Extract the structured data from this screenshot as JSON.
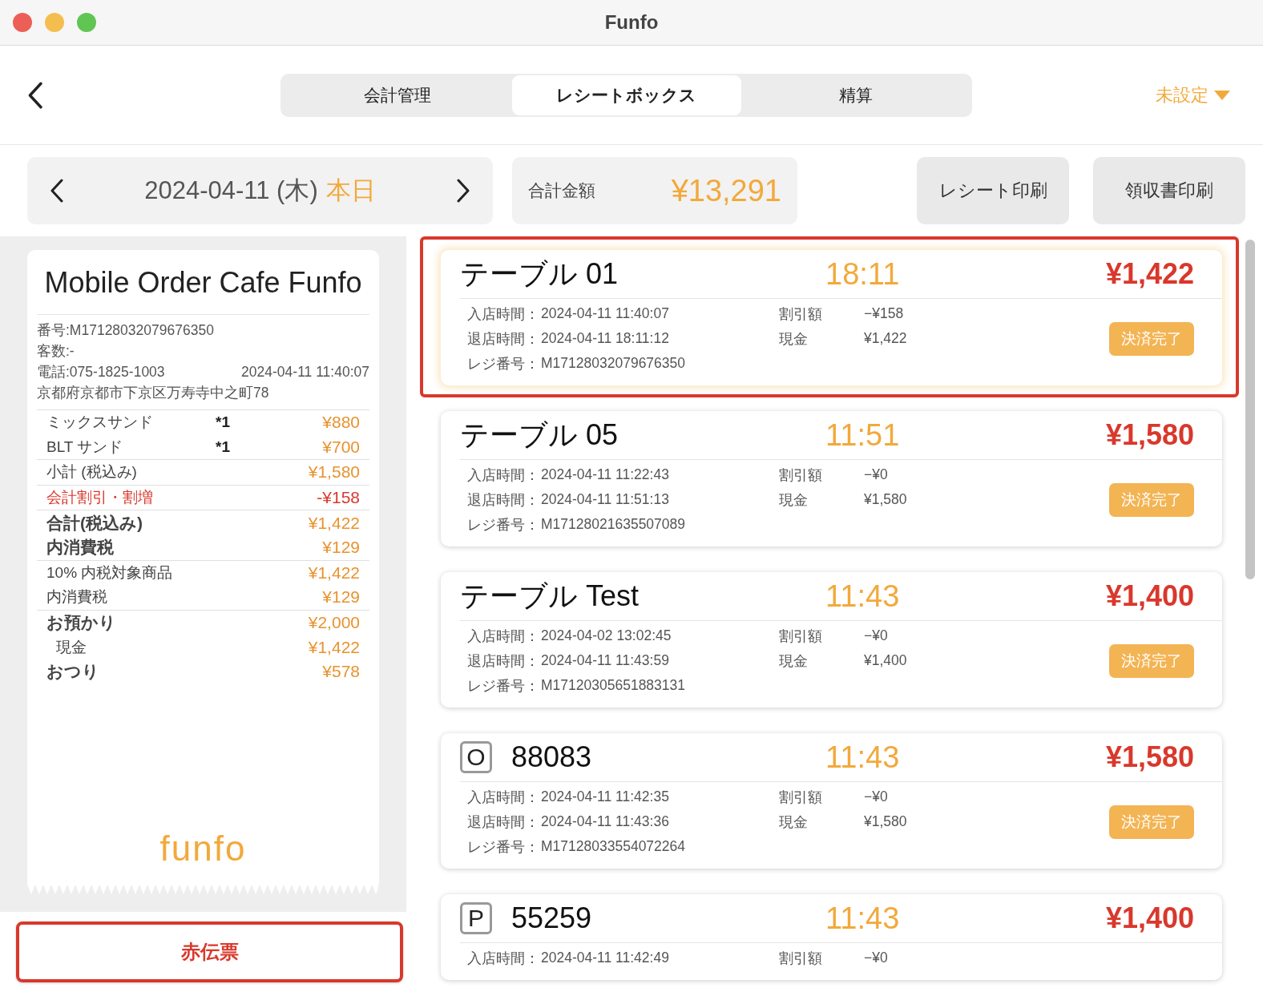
{
  "window": {
    "title": "Funfo"
  },
  "tabs": [
    {
      "label": "会計管理",
      "selected": false
    },
    {
      "label": "レシートボックス",
      "selected": true
    },
    {
      "label": "精算",
      "selected": false
    }
  ],
  "store_menu": {
    "label": "未設定"
  },
  "date_bar": {
    "date": "2024-04-11 (木)",
    "today": "本日"
  },
  "total": {
    "label": "合計金額",
    "amount": "¥13,291"
  },
  "actions": [
    "レシート印刷",
    "領収書印刷"
  ],
  "receipt": {
    "store": "Mobile Order Cafe Funfo",
    "number": "番号:M17128032079676350",
    "guests": "客数:-",
    "phone": "電話:075-1825-1003",
    "datetime": "2024-04-11 11:40:07",
    "address": "京都府京都市下京区万寿寺中之町78",
    "rows": [
      {
        "kind": "item",
        "label": "ミックスサンド",
        "qty": "*1",
        "value": "¥880",
        "rule": true
      },
      {
        "kind": "item",
        "label": "BLT サンド",
        "qty": "*1",
        "value": "¥700",
        "rule": false
      },
      {
        "kind": "plain",
        "label": "小計 (税込み)",
        "value": "¥1,580",
        "rule": true
      },
      {
        "kind": "discount",
        "label": "会計割引・割増",
        "value": "-¥158",
        "rule": true
      },
      {
        "kind": "strong",
        "label": "合計(税込み)",
        "value": "¥1,422",
        "rule": true
      },
      {
        "kind": "strong",
        "label": "内消費税",
        "value": "¥129",
        "rule": false
      },
      {
        "kind": "plain",
        "label": "10% 内税対象商品",
        "value": "¥1,422",
        "rule": true
      },
      {
        "kind": "plain",
        "label": "内消費税",
        "value": "¥129",
        "rule": false
      },
      {
        "kind": "strong",
        "label": "お預かり",
        "value": "¥2,000",
        "rule": true
      },
      {
        "kind": "indent",
        "label": "現金",
        "value": "¥1,422",
        "rule": false
      },
      {
        "kind": "strong",
        "label": "おつり",
        "value": "¥578",
        "rule": false
      }
    ],
    "logo": "funfo"
  },
  "void_button": {
    "label": "赤伝票",
    "highlighted": true
  },
  "orders": [
    {
      "title": "テーブル 01",
      "time": "18:11",
      "amount": "¥1,422",
      "selected": true,
      "status": "決済完了",
      "times": [
        {
          "label": "入店時間：",
          "value": "2024-04-11 11:40:07"
        },
        {
          "label": "退店時間：",
          "value": "2024-04-11 18:11:12"
        },
        {
          "label": "レジ番号：",
          "value": "M17128032079676350"
        }
      ],
      "payments": [
        {
          "label": "割引額",
          "value": "−¥158"
        },
        {
          "label": "現金",
          "value": "¥1,422"
        }
      ]
    },
    {
      "title": "テーブル 05",
      "time": "11:51",
      "amount": "¥1,580",
      "selected": false,
      "status": "決済完了",
      "times": [
        {
          "label": "入店時間：",
          "value": "2024-04-11 11:22:43"
        },
        {
          "label": "退店時間：",
          "value": "2024-04-11 11:51:13"
        },
        {
          "label": "レジ番号：",
          "value": "M17128021635507089"
        }
      ],
      "payments": [
        {
          "label": "割引額",
          "value": "−¥0"
        },
        {
          "label": "現金",
          "value": "¥1,580"
        }
      ]
    },
    {
      "title": "テーブル Test",
      "time": "11:43",
      "amount": "¥1,400",
      "selected": false,
      "status": "決済完了",
      "times": [
        {
          "label": "入店時間：",
          "value": "2024-04-02 13:02:45"
        },
        {
          "label": "退店時間：",
          "value": "2024-04-11 11:43:59"
        },
        {
          "label": "レジ番号：",
          "value": "M17120305651883131"
        }
      ],
      "payments": [
        {
          "label": "割引額",
          "value": "−¥0"
        },
        {
          "label": "現金",
          "value": "¥1,400"
        }
      ]
    },
    {
      "badge": "O",
      "title": "88083",
      "time": "11:43",
      "amount": "¥1,580",
      "selected": false,
      "status": "決済完了",
      "times": [
        {
          "label": "入店時間：",
          "value": "2024-04-11 11:42:35"
        },
        {
          "label": "退店時間：",
          "value": "2024-04-11 11:43:36"
        },
        {
          "label": "レジ番号：",
          "value": "M17128033554072264"
        }
      ],
      "payments": [
        {
          "label": "割引額",
          "value": "−¥0"
        },
        {
          "label": "現金",
          "value": "¥1,580"
        }
      ]
    },
    {
      "badge": "P",
      "title": "55259",
      "time": "11:43",
      "amount": "¥1,400",
      "selected": false,
      "times": [
        {
          "label": "入店時間：",
          "value": "2024-04-11 11:42:49"
        }
      ],
      "payments": [
        {
          "label": "割引額",
          "value": "−¥0"
        }
      ]
    }
  ]
}
